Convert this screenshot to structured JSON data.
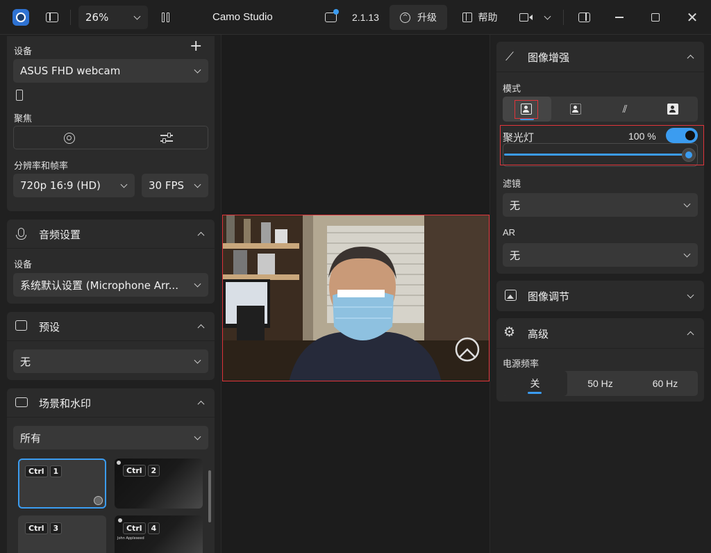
{
  "titlebar": {
    "zoom": "26%",
    "title": "Camo Studio",
    "version": "2.1.13",
    "upgrade_label": "升级",
    "help_label": "帮助",
    "icons": [
      "app-logo-icon",
      "sidebar-toggle-icon",
      "columns-icon",
      "chat-bubble-icon",
      "upgrade-icon",
      "book-icon",
      "camera-icon",
      "panel-icon",
      "minimize-icon",
      "maximize-icon",
      "close-icon"
    ],
    "notification_color": "#3b9cf0"
  },
  "left": {
    "device_label": "设备",
    "device_value": "ASUS FHD webcam",
    "focus_label": "聚焦",
    "resolution_label": "分辨率和帧率",
    "resolution_value": "720p 16:9 (HD)",
    "fps_value": "30 FPS",
    "audio": {
      "title": "音频设置",
      "device_label": "设备",
      "device_value": "系统默认设置 (Microphone Arr..."
    },
    "presets": {
      "title": "预设",
      "value": "无"
    },
    "scenes": {
      "title": "场景和水印",
      "filter_value": "所有",
      "tiles": [
        {
          "key": "Ctrl",
          "num": "1"
        },
        {
          "key": "Ctrl",
          "num": "2"
        },
        {
          "key": "Ctrl",
          "num": "3"
        },
        {
          "key": "Ctrl",
          "num": "4"
        }
      ],
      "tile4_caption": "John Appleseed"
    }
  },
  "right": {
    "enhance": {
      "title": "图像增强",
      "mode_label": "模式",
      "spotlight_label": "聚光灯",
      "spotlight_value": "100 %",
      "spotlight_level": 1.0,
      "toggle_on": true,
      "filter_label": "滤镜",
      "filter_value": "无",
      "ar_label": "AR",
      "ar_value": "无"
    },
    "adjust": {
      "title": "图像调节"
    },
    "advanced": {
      "title": "高级",
      "power_label": "电源频率",
      "options": [
        "关",
        "50 Hz",
        "60 Hz"
      ],
      "selected": "关"
    }
  },
  "colors": {
    "accent": "#3b9cf0",
    "highlight": "#e0353b"
  }
}
